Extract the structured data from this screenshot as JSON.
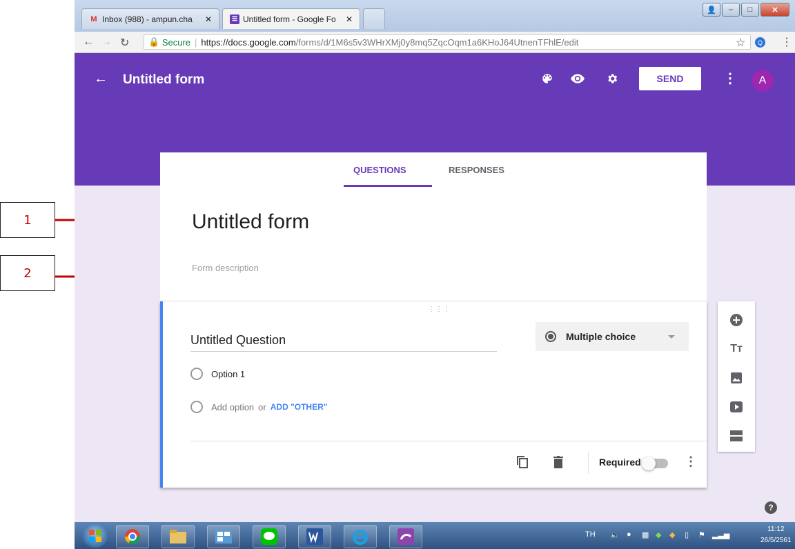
{
  "annotations": [
    {
      "number": "1"
    },
    {
      "number": "2"
    }
  ],
  "browser": {
    "tabs": [
      {
        "label": "Inbox (988) - ampun.cha",
        "icon": "gmail-icon"
      },
      {
        "label": "Untitled form - Google Fo",
        "icon": "forms-icon"
      }
    ],
    "secure_label": "Secure",
    "url_domain": "https://docs.google.com",
    "url_path": "/forms/d/1M6s5v3WHrXMj0y8mq5ZqcOqm1a6KHoJ64UtnenTFhlE/edit",
    "ext_letter": "Q"
  },
  "header": {
    "title": "Untitled form",
    "send_label": "SEND",
    "avatar_letter": "A"
  },
  "form_tabs": {
    "questions": "QUESTIONS",
    "responses": "RESPONSES"
  },
  "form": {
    "title": "Untitled form",
    "description_placeholder": "Form description"
  },
  "question": {
    "title": "Untitled Question",
    "type": "Multiple choice",
    "option1": "Option 1",
    "add_option": "Add option",
    "or_text": "or",
    "add_other": "ADD \"OTHER\"",
    "required_label": "Required",
    "required_on": false
  },
  "help_symbol": "?",
  "taskbar": {
    "language": "TH",
    "time": "11:12",
    "date": "26/5/2561"
  },
  "colors": {
    "header": "#673ab7",
    "accent": "#4285f4",
    "annotation": "#c00000"
  }
}
